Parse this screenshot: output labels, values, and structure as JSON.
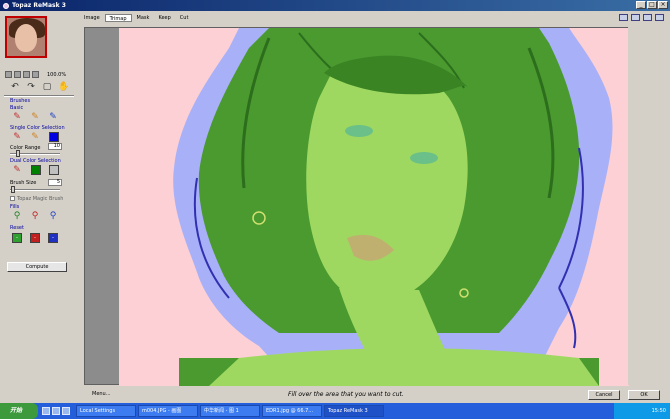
{
  "window": {
    "title": "Topaz ReMask 3"
  },
  "tabs": [
    {
      "label": "Image"
    },
    {
      "label": "Trimap"
    },
    {
      "label": "Mask"
    },
    {
      "label": "Keep"
    },
    {
      "label": "Cut"
    }
  ],
  "left_panel": {
    "zoom_value": "100.0%",
    "brushes_title": "Brushes",
    "basic_label": "Basic",
    "single_color_label": "Single Color Selection",
    "color_range_label": "Color Range",
    "color_range_value": "10",
    "dual_color_label": "Dual Color Selection",
    "brush_size_label": "Brush Size",
    "brush_size_value": "5",
    "magic_brush_label": "Topaz Magic Brush",
    "fills_label": "Fills",
    "reset_label": "Reset",
    "compute_label": "Compute"
  },
  "status": {
    "menu_label": "Menu...",
    "hint": "Fill over the area that you want to cut.",
    "cancel_label": "Cancel",
    "ok_label": "OK"
  },
  "taskbar": {
    "start_label": "开始",
    "tasks": [
      {
        "label": "Local Settings"
      },
      {
        "label": "m004.JPG - 画图"
      },
      {
        "label": "中华新闻 - 图 1"
      },
      {
        "label": "EDR1.jpg @ 66.7..."
      },
      {
        "label": "Topaz ReMask 3"
      }
    ],
    "clock": "15:50"
  },
  "colors": {
    "canvas_bg": "#fcd0d4",
    "keep_green": "#5cb040",
    "unknown_blue": "#a8b0f8",
    "swatch_blue": "#0000e0",
    "swatch_green": "#008000",
    "swatch_gray": "#c0c0c0"
  }
}
